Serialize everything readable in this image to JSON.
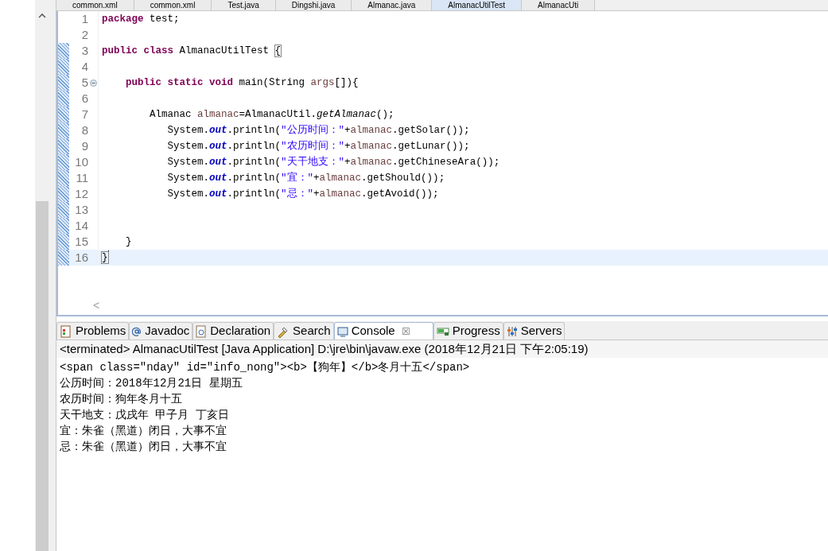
{
  "editor_tabs": [
    {
      "label": "common.xml",
      "selected": false
    },
    {
      "label": "common.xml",
      "selected": false
    },
    {
      "label": "Test.java",
      "selected": false
    },
    {
      "label": "Dingshi.java",
      "selected": false
    },
    {
      "label": "Almanac.java",
      "selected": false
    },
    {
      "label": "AlmanacUtilTest",
      "selected": true
    },
    {
      "label": "AlmanacUti",
      "selected": false
    }
  ],
  "code_lines": [
    {
      "number": "1",
      "marked": false,
      "fold": false,
      "current": false,
      "tokens": [
        {
          "kind": "keyword",
          "text": "package"
        },
        {
          "kind": "plain",
          "text": " test;"
        }
      ]
    },
    {
      "number": "2",
      "marked": false,
      "fold": false,
      "current": false
    },
    {
      "number": "3",
      "marked": true,
      "fold": false,
      "current": false,
      "tokens": [
        {
          "kind": "keyword",
          "text": "public class"
        },
        {
          "kind": "plain",
          "text": " AlmanacUtilTest "
        },
        {
          "kind": "bracket",
          "text": "{"
        }
      ]
    },
    {
      "number": "4",
      "marked": true,
      "fold": false,
      "current": false
    },
    {
      "number": "5",
      "marked": true,
      "fold": true,
      "current": false,
      "tokens": [
        {
          "kind": "keyword",
          "text": "    public static void"
        },
        {
          "kind": "plain",
          "text": " main(String "
        },
        {
          "kind": "variable",
          "text": "args"
        },
        {
          "kind": "plain",
          "text": "[]){"
        }
      ]
    },
    {
      "number": "6",
      "marked": true,
      "fold": false,
      "current": false
    },
    {
      "number": "7",
      "marked": true,
      "fold": false,
      "current": false,
      "tokens": [
        {
          "kind": "plain",
          "text": "        Almanac "
        },
        {
          "kind": "variable",
          "text": "almanac"
        },
        {
          "kind": "plain",
          "text": "=AlmanacUtil."
        },
        {
          "kind": "static",
          "text": "getAlmanac"
        },
        {
          "kind": "plain",
          "text": "();"
        }
      ]
    },
    {
      "number": "8",
      "marked": true,
      "fold": false,
      "current": false,
      "tokens": [
        {
          "kind": "plain",
          "text": "           System."
        },
        {
          "kind": "field",
          "text": "out"
        },
        {
          "kind": "plain",
          "text": ".println("
        },
        {
          "kind": "string",
          "text": "\"公历时间：\""
        },
        {
          "kind": "plain",
          "text": "+"
        },
        {
          "kind": "variable",
          "text": "almanac"
        },
        {
          "kind": "plain",
          "text": ".getSolar());"
        }
      ]
    },
    {
      "number": "9",
      "marked": true,
      "fold": false,
      "current": false,
      "tokens": [
        {
          "kind": "plain",
          "text": "           System."
        },
        {
          "kind": "field",
          "text": "out"
        },
        {
          "kind": "plain",
          "text": ".println("
        },
        {
          "kind": "string",
          "text": "\"农历时间：\""
        },
        {
          "kind": "plain",
          "text": "+"
        },
        {
          "kind": "variable",
          "text": "almanac"
        },
        {
          "kind": "plain",
          "text": ".getLunar());"
        }
      ]
    },
    {
      "number": "10",
      "marked": true,
      "fold": false,
      "current": false,
      "tokens": [
        {
          "kind": "plain",
          "text": "           System."
        },
        {
          "kind": "field",
          "text": "out"
        },
        {
          "kind": "plain",
          "text": ".println("
        },
        {
          "kind": "string",
          "text": "\"天干地支：\""
        },
        {
          "kind": "plain",
          "text": "+"
        },
        {
          "kind": "variable",
          "text": "almanac"
        },
        {
          "kind": "plain",
          "text": ".getChineseAra());"
        }
      ]
    },
    {
      "number": "11",
      "marked": true,
      "fold": false,
      "current": false,
      "tokens": [
        {
          "kind": "plain",
          "text": "           System."
        },
        {
          "kind": "field",
          "text": "out"
        },
        {
          "kind": "plain",
          "text": ".println("
        },
        {
          "kind": "string",
          "text": "\"宜：\""
        },
        {
          "kind": "plain",
          "text": "+"
        },
        {
          "kind": "variable",
          "text": "almanac"
        },
        {
          "kind": "plain",
          "text": ".getShould());"
        }
      ]
    },
    {
      "number": "12",
      "marked": true,
      "fold": false,
      "current": false,
      "tokens": [
        {
          "kind": "plain",
          "text": "           System."
        },
        {
          "kind": "field",
          "text": "out"
        },
        {
          "kind": "plain",
          "text": ".println("
        },
        {
          "kind": "string",
          "text": "\"忌：\""
        },
        {
          "kind": "plain",
          "text": "+"
        },
        {
          "kind": "variable",
          "text": "almanac"
        },
        {
          "kind": "plain",
          "text": ".getAvoid());"
        }
      ]
    },
    {
      "number": "13",
      "marked": true,
      "fold": false,
      "current": false
    },
    {
      "number": "14",
      "marked": true,
      "fold": false,
      "current": false
    },
    {
      "number": "15",
      "marked": true,
      "fold": false,
      "current": false,
      "tokens": [
        {
          "kind": "plain",
          "text": "    }"
        }
      ]
    },
    {
      "number": "16",
      "marked": true,
      "fold": false,
      "current": true,
      "tokens": [
        {
          "kind": "bracket",
          "text": "}"
        }
      ]
    }
  ],
  "horizontal_scroll": {
    "arrow": "<"
  },
  "view_tabs": [
    {
      "label": "Problems",
      "selected": false
    },
    {
      "label": "Javadoc",
      "selected": false
    },
    {
      "label": "Declaration",
      "selected": false
    },
    {
      "label": "Search",
      "selected": false
    },
    {
      "label": "Console",
      "selected": true,
      "close": "☒"
    },
    {
      "label": "Progress",
      "selected": false
    },
    {
      "label": "Servers",
      "selected": false
    }
  ],
  "console": {
    "status": "<terminated> AlmanacUtilTest [Java Application] D:\\jre\\bin\\javaw.exe (2018年12月21日 下午2:05:19)",
    "output": [
      "<span class=\"nday\" id=\"info_nong\"><b>【狗年】</b>冬月十五</span>",
      "公历时间：2018年12月21日 星期五",
      "农历时间：狗年冬月十五",
      "天干地支：戊戌年 甲子月 丁亥日",
      "宜：朱雀（黑道）闭日，大事不宜",
      "忌：朱雀（黑道）闭日，大事不宜"
    ]
  }
}
